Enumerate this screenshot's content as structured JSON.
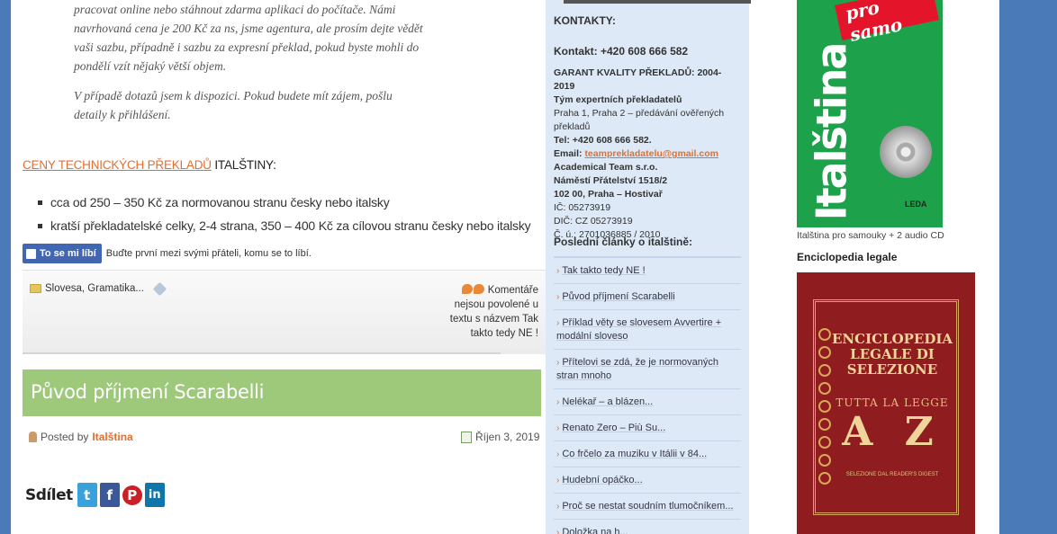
{
  "quote": {
    "p1": "pracovat online nebo stáhnout zdarma aplikaci do počítače. Námi navrhovaná cena je 200 Kč za ns, jsme agentura, ale prosím dejte vědět vaši sazbu, případně i sazbu za expresní překlad, pokud byste mohli do pondělí vzít nějaký větší objem.",
    "p2": "V případě dotazů jsem k dispozici. Pokud budete mít zájem, pošlu detaily k přihlášení."
  },
  "prices": {
    "link": "CENY TECHNICKÝCH PŘEKLADŮ",
    "suffix": " ITALŠTINY:",
    "items": [
      "cca od 250 – 350 Kč za normovanou stranu česky nebo italsky",
      "kratší překladatelské celky, 2-4 strana, 350 – 400 Kč za cílovou stranu česky nebo italsky"
    ]
  },
  "like": {
    "button": "To se mi líbí",
    "text": "Buďte první mezi svými přáteli, komu se to líbí."
  },
  "meta": {
    "categories": "Slovesa, Gramatika...",
    "comments": "Komentáře nejsou povolené u textu s názvem Tak takto tedy NE !"
  },
  "post": {
    "title": "Původ příjmení Scarabelli",
    "posted_by": "Posted by",
    "author": "Italština",
    "date": "Říjen 3, 2019",
    "share_label": "Sdílet"
  },
  "contacts": {
    "heading": "KONTAKTY:",
    "phone": "Kontakt: +420 608 666 582",
    "guarantee": "GARANT KVALITY PŘEKLADŮ: 2004-2019",
    "team": "Tým expertních překladatelů",
    "location": "Praha 1, Praha 2 – předávání ověřených překladů",
    "tel": "Tel: +420 608 666 582.",
    "email_label": "Email: ",
    "email": "teamprekladatelu@gmail.com",
    "company": "Academical Team s.r.o.",
    "street": "Náměstí Přátelství 1518/2",
    "city": "102 00, Praha – Hostivař",
    "ic": "IČ: 05273919",
    "dic": "DIČ: CZ 05273919",
    "account": "Č. ú.: 2701036885 / 2010"
  },
  "recent": {
    "heading": "Poslední články o italštině:",
    "items": [
      "Tak takto tedy NE !",
      "Původ příjmení Scarabelli",
      "Příklad věty se slovesem Avvertire + modální sloveso",
      "Přítelovi se zdá, že je normovaných stran mnoho",
      "Nelékař – a blázen...",
      "Renato Zero – Più Su...",
      "Co frčelo za muziku v Itálii v 84...",
      "Hudební opáčko...",
      "Proč se nestat soudním tlumočníkem...",
      "Doložka na h..."
    ]
  },
  "books": {
    "book1_ribbon": "pro samo",
    "book1_spine": "Italština",
    "book1_publisher": "LEDA",
    "book1_caption": "Italština pro samouky + 2 audio CD",
    "book2_heading": "Enciclopedia legale",
    "book2_title": "ENCICLOPEDIA LEGALE DI SELEZIONE",
    "book2_subtitle": "TUTTA LA LEGGE",
    "book2_az": "A Z",
    "book2_publisher": "SELEZIONE DAL READER'S DIGEST"
  }
}
